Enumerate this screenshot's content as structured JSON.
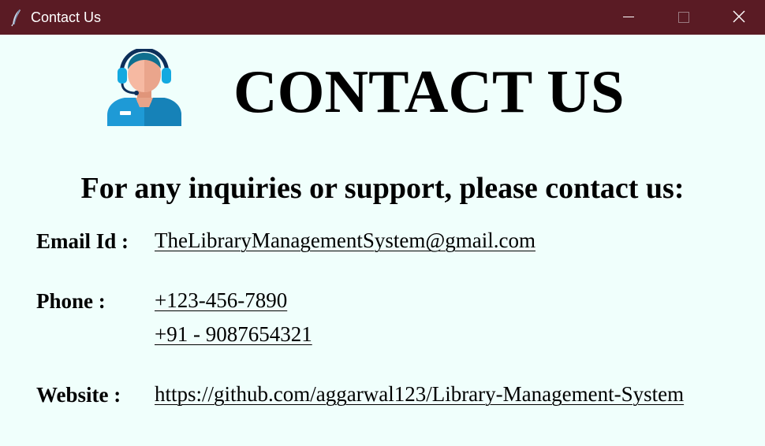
{
  "window": {
    "title": "Contact Us",
    "titlebar_color": "#5a1b24",
    "background_color": "#f0fffc",
    "app_icon": "feather-icon",
    "controls": [
      "minimize-icon",
      "maximize-icon",
      "close-icon"
    ]
  },
  "header": {
    "icon": "customer-support-icon",
    "title": "CONTACT US"
  },
  "main": {
    "subheading": "For any inquiries or support, please contact us:",
    "email": {
      "label": "Email Id :",
      "value": "TheLibraryManagementSystem@gmail.com"
    },
    "phone": {
      "label": "Phone :",
      "values": [
        "+123-456-7890",
        "+91 - 9087654321"
      ]
    },
    "website": {
      "label": "Website :",
      "value": "https://github.com/aggarwal123/Library-Management-System"
    }
  }
}
